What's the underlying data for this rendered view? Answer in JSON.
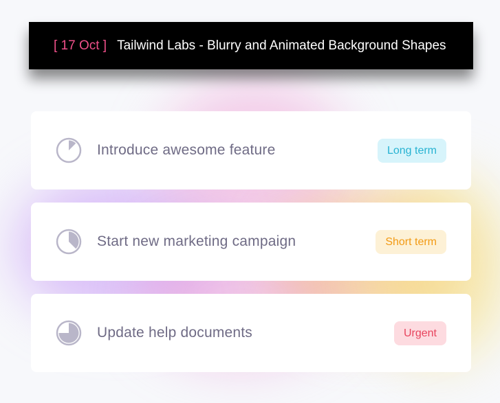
{
  "header": {
    "date": "[ 17 Oct ]",
    "title": "Tailwind Labs - Blurry and Animated Background Shapes"
  },
  "tasks": [
    {
      "title": "Introduce awesome feature",
      "badge": "Long term",
      "progress": 0.125
    },
    {
      "title": "Start new marketing campaign",
      "badge": "Short term",
      "progress": 0.375
    },
    {
      "title": "Update help documents",
      "badge": "Urgent",
      "progress": 0.75
    }
  ],
  "colors": {
    "date_accent": "#f0508a",
    "long_term_text": "#27b3d2",
    "long_term_bg": "#d7f4fb",
    "short_term_text": "#f29a14",
    "short_term_bg": "#fdf1d6",
    "urgent_text": "#e8445d",
    "urgent_bg": "#fddbe0",
    "icon": "#b9b6c9"
  }
}
